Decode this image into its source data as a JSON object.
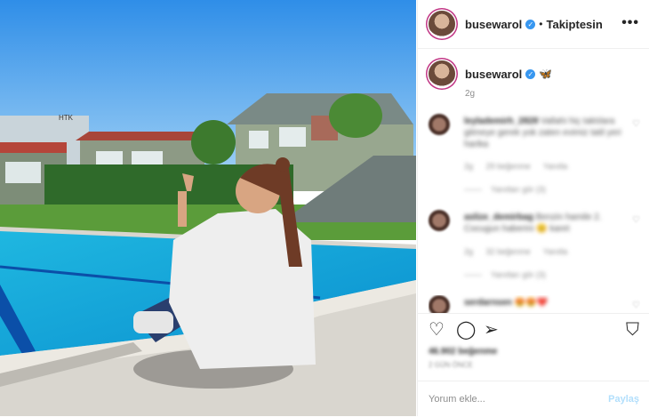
{
  "post": {
    "username": "busewarol",
    "follow_status": "Takiptesin",
    "separator": "•",
    "more_glyph": "•••",
    "caption_emoji": "🦋",
    "time_ago": "2g"
  },
  "comments": [
    {
      "username": "leylademirh_2828",
      "text": "Vallahi hiç taktılara gitmeye gerek yok zaten evimiz tatil yeri harika",
      "meta": [
        "2g",
        "29 beğenme",
        "Yanıtla"
      ],
      "replies": "Yanıtları gör (3)"
    },
    {
      "username": "aslize_demirbag",
      "text": "Benzin hamile 2. Cocugun haberini 😊 karet",
      "meta": [
        "2g",
        "32 beğenme",
        "Yanıtla"
      ],
      "replies": "Yanıtları gör (3)"
    },
    {
      "username": "serdarnsen",
      "text": "😍😍❤️",
      "meta": [],
      "replies": ""
    }
  ],
  "actions": {
    "like_icon": "♡",
    "comment_icon": "◯",
    "share_icon": "➢",
    "save_icon": "⛉"
  },
  "likes_text": "46.902 beğenme",
  "date_text": "2 GÜN ÖNCE",
  "add_comment": {
    "placeholder": "Yorum ekle...",
    "post_label": "Paylaş"
  },
  "colors": {
    "verified": "#3897f0",
    "post_button_disabled": "#b2dffc",
    "avatar_ring": "#c13584"
  },
  "photo_sign": "HTK"
}
